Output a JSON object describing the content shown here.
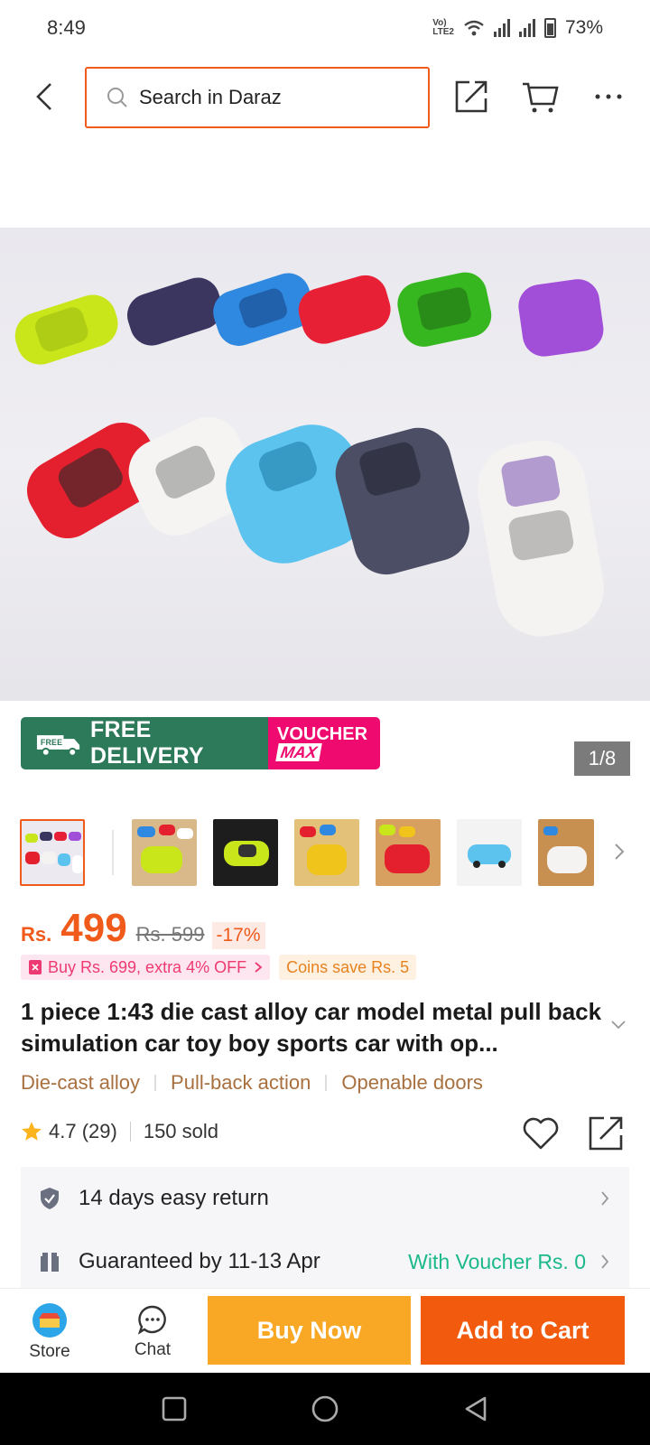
{
  "status_bar": {
    "time": "8:49",
    "battery": "73%",
    "volte": "Vo LTE"
  },
  "search": {
    "placeholder": "Search in Daraz"
  },
  "icons": {
    "back": "back-arrow-icon",
    "share": "share-icon",
    "cart": "cart-icon",
    "more": "more-icon"
  },
  "promo": {
    "free_delivery": "FREE DELIVERY",
    "voucher": "VOUCHER",
    "max": "MAX",
    "badge_small": "FREE"
  },
  "gallery": {
    "counter": "1/8"
  },
  "price": {
    "currency": "Rs.",
    "amount": "499",
    "original": "Rs. 599",
    "discount": "-17%"
  },
  "tags": {
    "offer": "Buy Rs. 699, extra 4% OFF",
    "coins": "Coins save Rs. 5"
  },
  "product": {
    "title": "1 piece 1:43 die cast alloy car model metal pull back simulation car toy boy sports car with op...",
    "attributes": [
      "Die-cast alloy",
      "Pull-back action",
      "Openable doors"
    ],
    "rating": "4.7 (29)",
    "sold": "150 sold"
  },
  "info": {
    "return": "14 days easy return",
    "delivery": "Guaranteed by 11-13 Apr",
    "voucher": "With Voucher Rs. 0"
  },
  "bottom_bar": {
    "store": "Store",
    "chat": "Chat",
    "buy_now": "Buy Now",
    "add_to_cart": "Add to Cart"
  },
  "colors": {
    "brand": "#f05a1a",
    "buy_now": "#f9a825",
    "add_to_cart": "#f25a0e",
    "free_delivery": "#2c7a5a",
    "voucher": "#ee0a6e",
    "green_text": "#1bb98a"
  }
}
